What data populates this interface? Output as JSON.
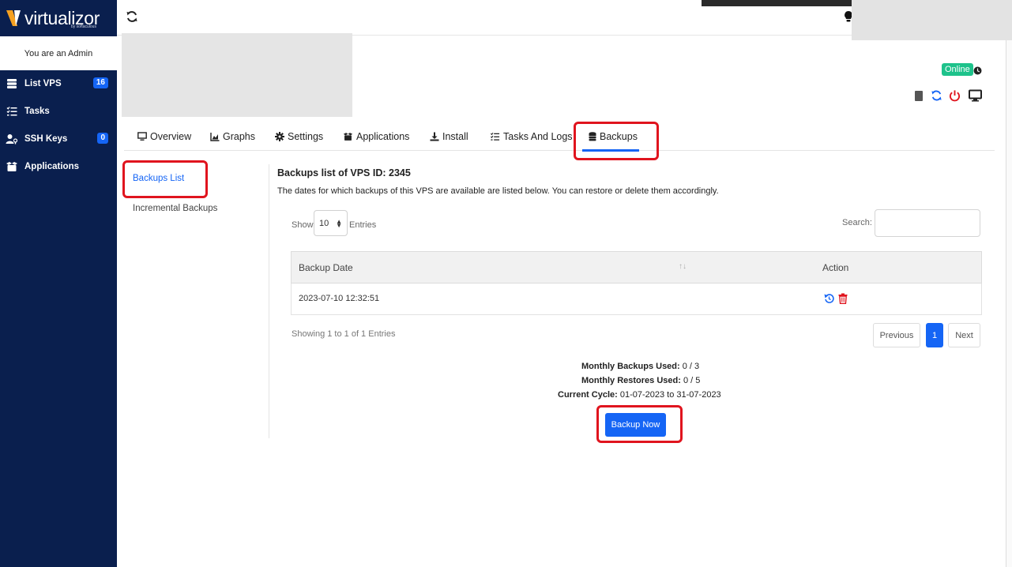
{
  "sidebar": {
    "logo_text": "virtualizor",
    "logo_sub": "by softaculous",
    "admin_label": "You are an Admin",
    "items": [
      {
        "label": "List VPS",
        "icon": "server-icon",
        "badge": "16"
      },
      {
        "label": "Tasks",
        "icon": "tasks-icon",
        "badge": ""
      },
      {
        "label": "SSH Keys",
        "icon": "user-key-icon",
        "badge": "0"
      },
      {
        "label": "Applications",
        "icon": "apps-icon",
        "badge": ""
      }
    ]
  },
  "status": {
    "online": "Online"
  },
  "tabs": [
    {
      "label": "Overview",
      "icon": "monitor-icon"
    },
    {
      "label": "Graphs",
      "icon": "chart-icon"
    },
    {
      "label": "Settings",
      "icon": "gear-icon"
    },
    {
      "label": "Applications",
      "icon": "apps-icon"
    },
    {
      "label": "Install",
      "icon": "download-icon"
    },
    {
      "label": "Tasks And Logs",
      "icon": "list-icon"
    },
    {
      "label": "Backups",
      "icon": "database-icon"
    }
  ],
  "side_menu": {
    "backups_list": "Backups List",
    "incremental": "Incremental Backups"
  },
  "main": {
    "heading": "Backups list of VPS ID: 2345",
    "description": "The dates for which backups of this VPS are available are listed below. You can restore or delete them accordingly.",
    "show_label": "Show",
    "show_value": "10",
    "entries_label": "Entries",
    "search_label": "Search:",
    "columns": [
      "Backup Date",
      "Action"
    ],
    "rows": [
      {
        "date": "2023-07-10 12:32:51"
      }
    ],
    "showing": "Showing 1 to 1 of 1 Entries",
    "pagination": {
      "previous": "Previous",
      "page": "1",
      "next": "Next"
    },
    "stats": {
      "monthly_backups_label": "Monthly Backups Used:",
      "monthly_backups_value": " 0 / 3",
      "monthly_restores_label": "Monthly Restores Used:",
      "monthly_restores_value": " 0 / 5",
      "cycle_label": "Current Cycle:",
      "cycle_value": " 01-07-2023 to 31-07-2023"
    },
    "backup_now": "Backup Now"
  },
  "colors": {
    "sidebar_bg": "#0a1f4e",
    "accent": "#1565f5",
    "online": "#1ec28b",
    "highlight": "#e0141e"
  }
}
